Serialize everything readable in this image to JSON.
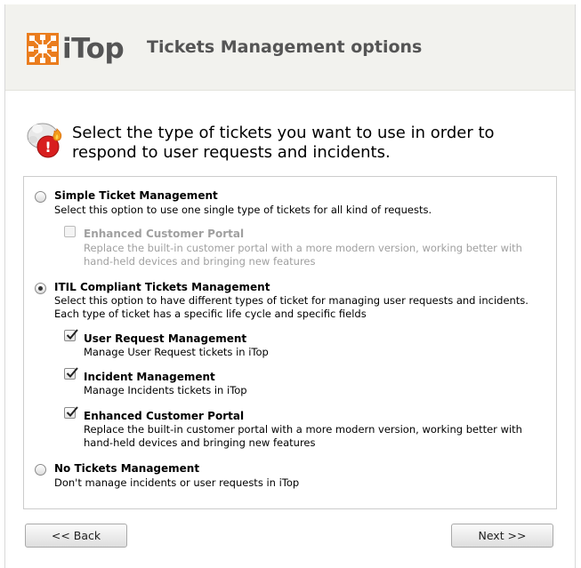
{
  "header": {
    "logo_text": "iTop",
    "title": "Tickets Management options"
  },
  "question": {
    "icon": "question-fire-icon",
    "text": "Select the type of tickets you want to use in order to respond to user requests and incidents."
  },
  "options": [
    {
      "title": "Simple Ticket Management",
      "description": "Select this option to use one single type of tickets for all kind of requests.",
      "selected": false,
      "sub_options": [
        {
          "title": "Enhanced Customer Portal",
          "description_line1": "Replace the built-in customer portal with a more modern version, working better with",
          "description_line2": "hand-held devices and bringing new features",
          "checked": false,
          "disabled": true
        }
      ]
    },
    {
      "title": "ITIL Compliant Tickets Management",
      "description_line1": "Select this option to have different types of ticket for managing user requests and incidents.",
      "description_line2": "Each type of ticket has a specific life cycle and specific fields",
      "selected": true,
      "sub_options": [
        {
          "title": "User Request Management",
          "description": "Manage User Request tickets in iTop",
          "checked": true,
          "disabled": false
        },
        {
          "title": "Incident Management",
          "description": "Manage Incidents tickets in iTop",
          "checked": true,
          "disabled": false
        },
        {
          "title": "Enhanced Customer Portal",
          "description_line1": "Replace the built-in customer portal with a more modern version, working better with",
          "description_line2": "hand-held devices and bringing new features",
          "checked": true,
          "disabled": false
        }
      ]
    },
    {
      "title": "No Tickets Management",
      "description": "Don't manage incidents or user requests in iTop",
      "selected": false
    }
  ],
  "buttons": {
    "back": "<< Back",
    "next": "Next >>"
  },
  "colors": {
    "brand_orange": "#ea7d1e",
    "header_bg": "#f2f2ee",
    "header_text": "#555555"
  }
}
